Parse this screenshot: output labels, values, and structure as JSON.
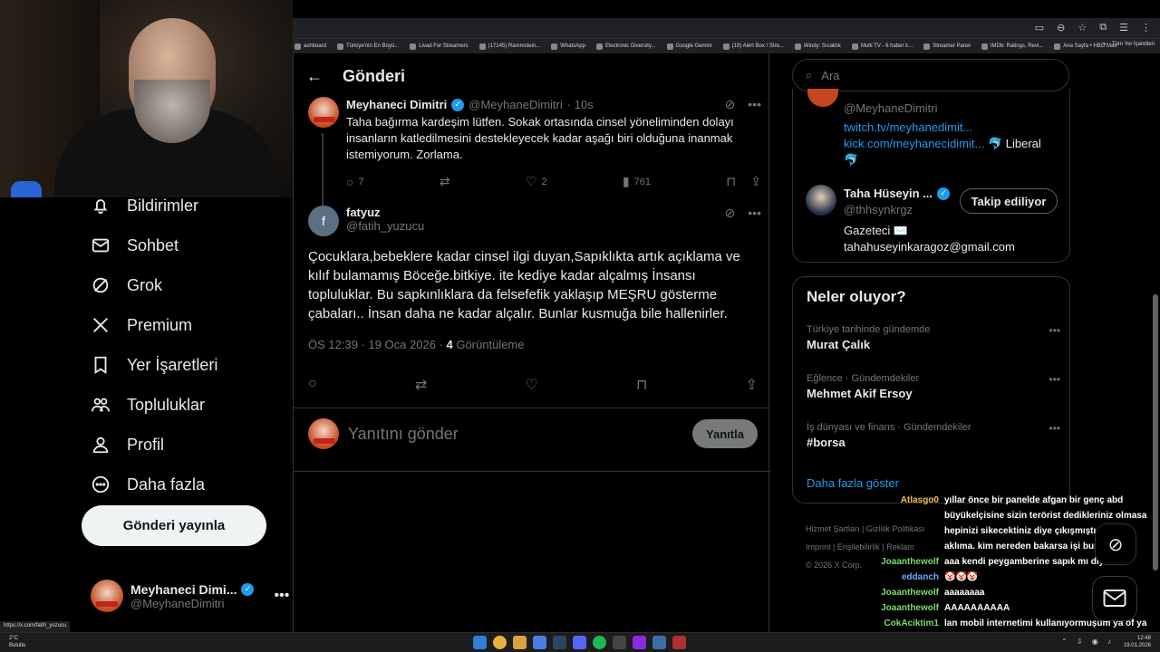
{
  "bookmarks": [
    "ashboard",
    "Türkiye'nin En Büyü...",
    "Livad For Streamers",
    "(17145) Rammstein...",
    "WhatsApp",
    "Electronic Diversity...",
    "Google Gemini",
    "(19) Alert Box / Stre...",
    "Windy: Sıcaklık",
    "Multi TV - 6 haber k...",
    "Streamer Panel",
    "IMDb: Ratings, Revi...",
    "Ana Sayfa • HBO Max"
  ],
  "bookmarks_more": "»",
  "bookmarks_folder": "Tüm Yer İşaretleri",
  "nav": {
    "items": [
      {
        "label": "Bildirimler",
        "icon": "bell-icon"
      },
      {
        "label": "Sohbet",
        "icon": "mail-icon"
      },
      {
        "label": "Grok",
        "icon": "grok-icon"
      },
      {
        "label": "Premium",
        "icon": "x-logo-icon"
      },
      {
        "label": "Yer İşaretleri",
        "icon": "bookmark-icon"
      },
      {
        "label": "Topluluklar",
        "icon": "communities-icon"
      },
      {
        "label": "Profil",
        "icon": "profile-icon"
      },
      {
        "label": "Daha fazla",
        "icon": "more-circle-icon"
      }
    ],
    "post_button": "Gönderi yayınla"
  },
  "account": {
    "name": "Meyhaneci Dimi...",
    "handle": "@MeyhaneDimitri",
    "more": "•••"
  },
  "status_url": "https://x.com/fatih_yuzucu",
  "main": {
    "title": "Gönderi",
    "tweet1": {
      "name": "Meyhaneci Dimitri",
      "handle": "@MeyhaneDimitri",
      "time": "· 10s",
      "text": "Taha bağırma kardeşim lütfen. Sokak ortasında cinsel yöneliminden dolayı insanların katledilmesini destekleyecek kadar aşağı biri olduğuna inanmak istemiyorum. Zorlama.",
      "replies": "7",
      "likes": "2",
      "views": "761"
    },
    "tweet2": {
      "avatar_letter": "f",
      "name": "fatyuz",
      "handle": "@fatih_yuzucu",
      "text": "Çocuklara,bebeklere kadar cinsel ilgi duyan,Sapıklıkta artık açıklama ve kılıf bulamamış Böceğe.bitkiye. ite kediye kadar alçalmış İnsansı topluluklar. Bu sapkınlıklara da felsefefik yaklaşıp MEŞRU gösterme çabaları.. İnsan daha ne kadar alçalır. Bunlar kusmuğa bile hallenirler.",
      "meta_time": "ÖS 12:39 · 19 Oca 2026 · ",
      "meta_views": "4",
      "meta_views_label": " Görüntüleme"
    },
    "reply_placeholder": "Yanıtını gönder",
    "reply_button": "Yanıtla"
  },
  "right": {
    "search_placeholder": "Ara",
    "profile_card": {
      "handle": "@MeyhaneDimitri",
      "link1": "twitch.tv/meyhanedimit...",
      "link2": "kick.com/meyhanecidimit...",
      "link2_suffix": " 🐬 Liberal",
      "link3": "🐬",
      "user_name": "Taha Hüseyin ...",
      "user_handle": "@thhsynkrgz",
      "user_bio1": "Gazeteci ✉️",
      "user_bio2": "tahahuseyinkaragoz@gmail.com",
      "follow_label": "Takip ediliyor"
    },
    "trends_title": "Neler oluyor?",
    "trends": [
      {
        "category": "Türkiye tarihinde gündemde",
        "name": "Murat Çalık"
      },
      {
        "category": "Eğlence · Gündemdekiler",
        "name": "Mehmet Akif Ersoy"
      },
      {
        "category": "İş dünyası ve finans · Gündemdekiler",
        "name": "#borsa"
      }
    ],
    "show_more": "Daha fazla göster",
    "footer": [
      "Hizmet Şartları",
      "Gizlilik Politikası",
      "Imprint",
      "Erişilebilirlik",
      "Reklam",
      "© 2026 X Corp."
    ]
  },
  "chat": [
    {
      "user": "Atlasgo0",
      "color": "#f0c04a",
      "msg": "yıllar önce bir panelde afgan bir genç abd büyükelçisine sizin terörist dedikleriniz olmasa hepinizi sikecektiniz diye çıkışmıştı o geldi aklıma. kim nereden bakarsa işi bunlar"
    },
    {
      "user": "Joaanthewolf",
      "color": "#7bdc6a",
      "msg": "aaa kendi peygamberine sapık mı diyor"
    },
    {
      "user": "eddanch",
      "color": "#6fa8ff",
      "msg": "🤡🤡🤡"
    },
    {
      "user": "Joaanthewolf",
      "color": "#7bdc6a",
      "msg": "aaaaaaaa"
    },
    {
      "user": "Joaanthewolf",
      "color": "#7bdc6a",
      "msg": "AAAAAAAAAA"
    },
    {
      "user": "CokAciktim1",
      "color": "#7bdc6a",
      "msg": "lan mobil internetimi kullanıyormuşum ya of ya bunca zamandır izliyorum"
    }
  ],
  "taskbar": {
    "weather_temp": "2°C",
    "weather_desc": "Bulutlu",
    "time": "12:48",
    "date": "19.01.2026"
  },
  "colors": {
    "accent": "#1d9bf0",
    "verified": "#1d9bf0",
    "border": "#2f3336"
  }
}
